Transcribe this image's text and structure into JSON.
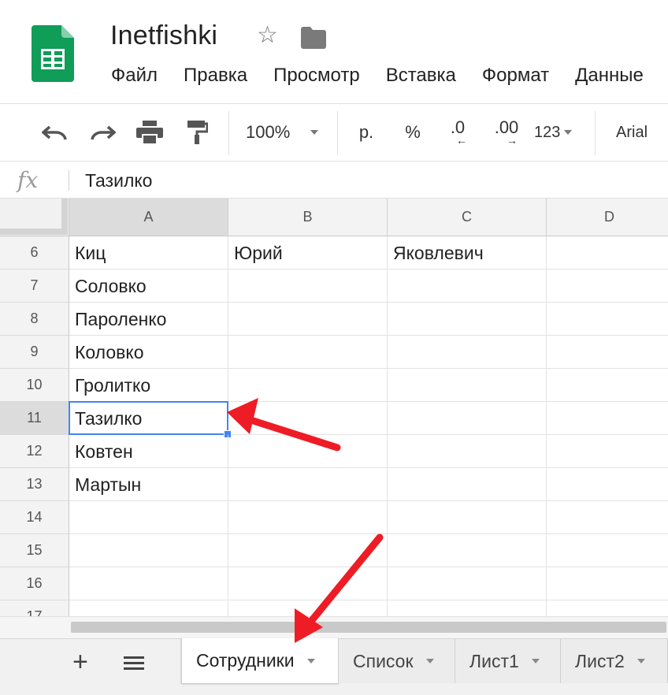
{
  "app": {
    "doc_title": "Inetfishki",
    "menu": [
      "Файл",
      "Правка",
      "Просмотр",
      "Вставка",
      "Формат",
      "Данные"
    ]
  },
  "toolbar": {
    "undo_icon": "undo-icon",
    "redo_icon": "redo-icon",
    "print_icon": "print-icon",
    "paint_format_icon": "paint-format-icon",
    "zoom": "100%",
    "currency": "р.",
    "percent": "%",
    "decrease_decimal": ".0",
    "increase_decimal": ".00",
    "more_formats": "123",
    "font": "Arial"
  },
  "formula_bar": {
    "fx": "fx",
    "value": "Тазилко"
  },
  "grid": {
    "columns": [
      "A",
      "B",
      "C",
      "D"
    ],
    "active_column": "A",
    "active_row": "11",
    "rows": [
      {
        "num": "6",
        "cells": [
          "Киц",
          "Юрий",
          "Яковлевич",
          ""
        ]
      },
      {
        "num": "7",
        "cells": [
          "Соловко",
          "",
          "",
          ""
        ]
      },
      {
        "num": "8",
        "cells": [
          "Пароленко",
          "",
          "",
          ""
        ]
      },
      {
        "num": "9",
        "cells": [
          "Коловко",
          "",
          "",
          ""
        ]
      },
      {
        "num": "10",
        "cells": [
          "Гролитко",
          "",
          "",
          ""
        ]
      },
      {
        "num": "11",
        "cells": [
          "Тазилко",
          "",
          "",
          ""
        ]
      },
      {
        "num": "12",
        "cells": [
          "Ковтен",
          "",
          "",
          ""
        ]
      },
      {
        "num": "13",
        "cells": [
          "Мартын",
          "",
          "",
          ""
        ]
      },
      {
        "num": "14",
        "cells": [
          "",
          "",
          "",
          ""
        ]
      },
      {
        "num": "15",
        "cells": [
          "",
          "",
          "",
          ""
        ]
      },
      {
        "num": "16",
        "cells": [
          "",
          "",
          "",
          ""
        ]
      },
      {
        "num": "17",
        "cells": [
          "",
          "",
          "",
          ""
        ]
      }
    ]
  },
  "sheets": {
    "add_label": "+",
    "tabs": [
      "Сотрудники",
      "Список",
      "Лист1",
      "Лист2"
    ],
    "active": "Сотрудники"
  },
  "colors": {
    "selection": "#4285f4",
    "annotation_arrow": "#ee1c25",
    "logo_green": "#0f9d58"
  }
}
